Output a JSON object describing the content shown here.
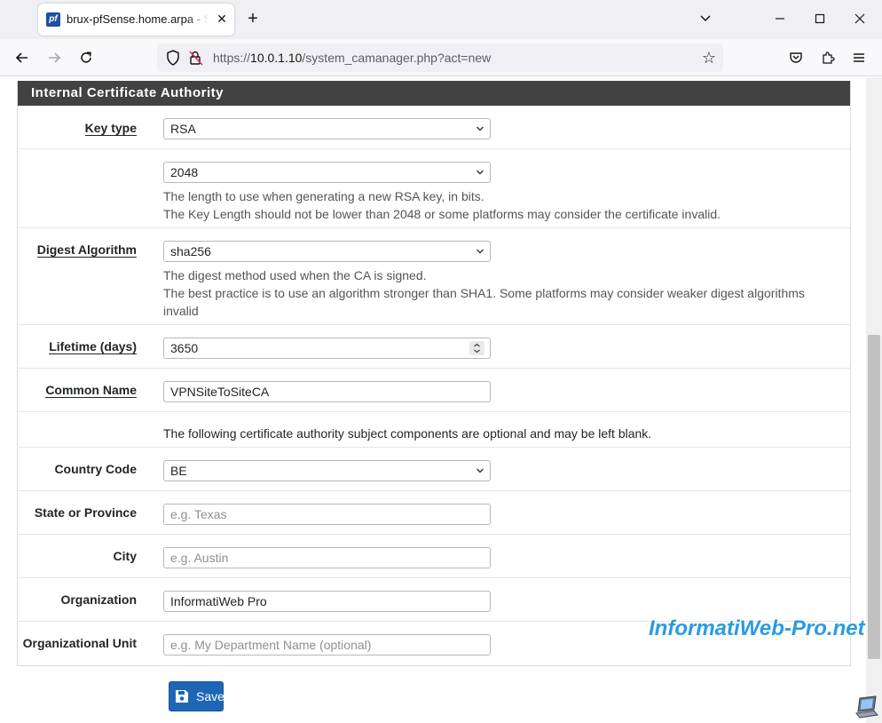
{
  "browser": {
    "tab_title": "brux-pfSense.home.arpa - System: Certificate Authority Manager",
    "favicon_text": "pf",
    "url_scheme": "https://",
    "url_host": "10.0.1.10",
    "url_path": "/system_camanager.php?act=new"
  },
  "panel": {
    "title": "Internal Certificate Authority"
  },
  "form": {
    "key_type": {
      "label": "Key type",
      "value": "RSA"
    },
    "key_length": {
      "value": "2048",
      "help1": "The length to use when generating a new RSA key, in bits.",
      "help2": "The Key Length should not be lower than 2048 or some platforms may consider the certificate invalid."
    },
    "digest": {
      "label": "Digest Algorithm",
      "value": "sha256",
      "help1": "The digest method used when the CA is signed.",
      "help2": "The best practice is to use an algorithm stronger than SHA1. Some platforms may consider weaker digest algorithms invalid"
    },
    "lifetime": {
      "label": "Lifetime (days)",
      "value": "3650"
    },
    "common_name": {
      "label": "Common Name",
      "value": "VPNSiteToSiteCA"
    },
    "optional_note": "The following certificate authority subject components are optional and may be left blank.",
    "country": {
      "label": "Country Code",
      "value": "BE"
    },
    "state": {
      "label": "State or Province",
      "placeholder": "e.g. Texas"
    },
    "city": {
      "label": "City",
      "placeholder": "e.g. Austin"
    },
    "organization": {
      "label": "Organization",
      "value": "InformatiWeb Pro"
    },
    "org_unit": {
      "label": "Organizational Unit",
      "placeholder": "e.g. My Department Name (optional)"
    }
  },
  "actions": {
    "save_label": "Save"
  },
  "watermark": "InformatiWeb-Pro.net",
  "colors": {
    "accent": "#1e66b5",
    "panel_header": "#424242",
    "watermark": "#2a9be0"
  }
}
